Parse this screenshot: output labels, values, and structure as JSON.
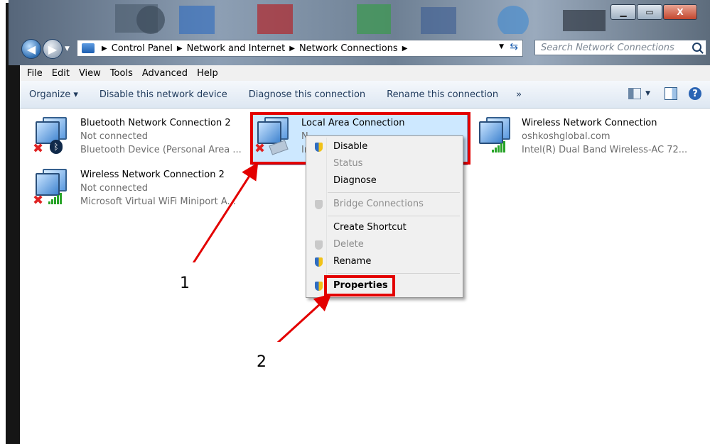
{
  "window": {
    "controls": [
      "minimize",
      "maximize",
      "close"
    ],
    "close_glyph": "X"
  },
  "address_bar": {
    "crumbs": [
      "Control Panel",
      "Network and Internet",
      "Network Connections"
    ],
    "search_placeholder": "Search Network Connections"
  },
  "menu": [
    "File",
    "Edit",
    "View",
    "Tools",
    "Advanced",
    "Help"
  ],
  "toolbar": {
    "organize": "Organize ▾",
    "items": [
      "Disable this network device",
      "Diagnose this connection",
      "Rename this connection"
    ],
    "more": "»",
    "help": "?"
  },
  "connections": [
    {
      "name": "Bluetooth Network Connection 2",
      "status": "Not connected",
      "device": "Bluetooth Device (Personal Area ..."
    },
    {
      "name": "Wireless Network Connection 2",
      "status": "Not connected",
      "device": "Microsoft Virtual WiFi Miniport A..."
    },
    {
      "name": "Local Area Connection",
      "status": "N",
      "device": "In"
    },
    {
      "name": "Wireless Network Connection",
      "status": "oshkoshglobal.com",
      "device": "Intel(R) Dual Band Wireless-AC 72..."
    }
  ],
  "context_menu": {
    "items": [
      {
        "label": "Disable",
        "enabled": true
      },
      {
        "label": "Status",
        "enabled": false
      },
      {
        "label": "Diagnose",
        "enabled": true
      },
      {
        "label": "Bridge Connections",
        "enabled": false
      },
      {
        "label": "Create Shortcut",
        "enabled": true
      },
      {
        "label": "Delete",
        "enabled": false
      },
      {
        "label": "Rename",
        "enabled": true
      },
      {
        "label": "Properties",
        "enabled": true
      }
    ]
  },
  "callouts": [
    "1",
    "2"
  ],
  "colors": {
    "highlight": "#e30000",
    "selection": "#cde8ff",
    "link_text": "#1e395b"
  }
}
